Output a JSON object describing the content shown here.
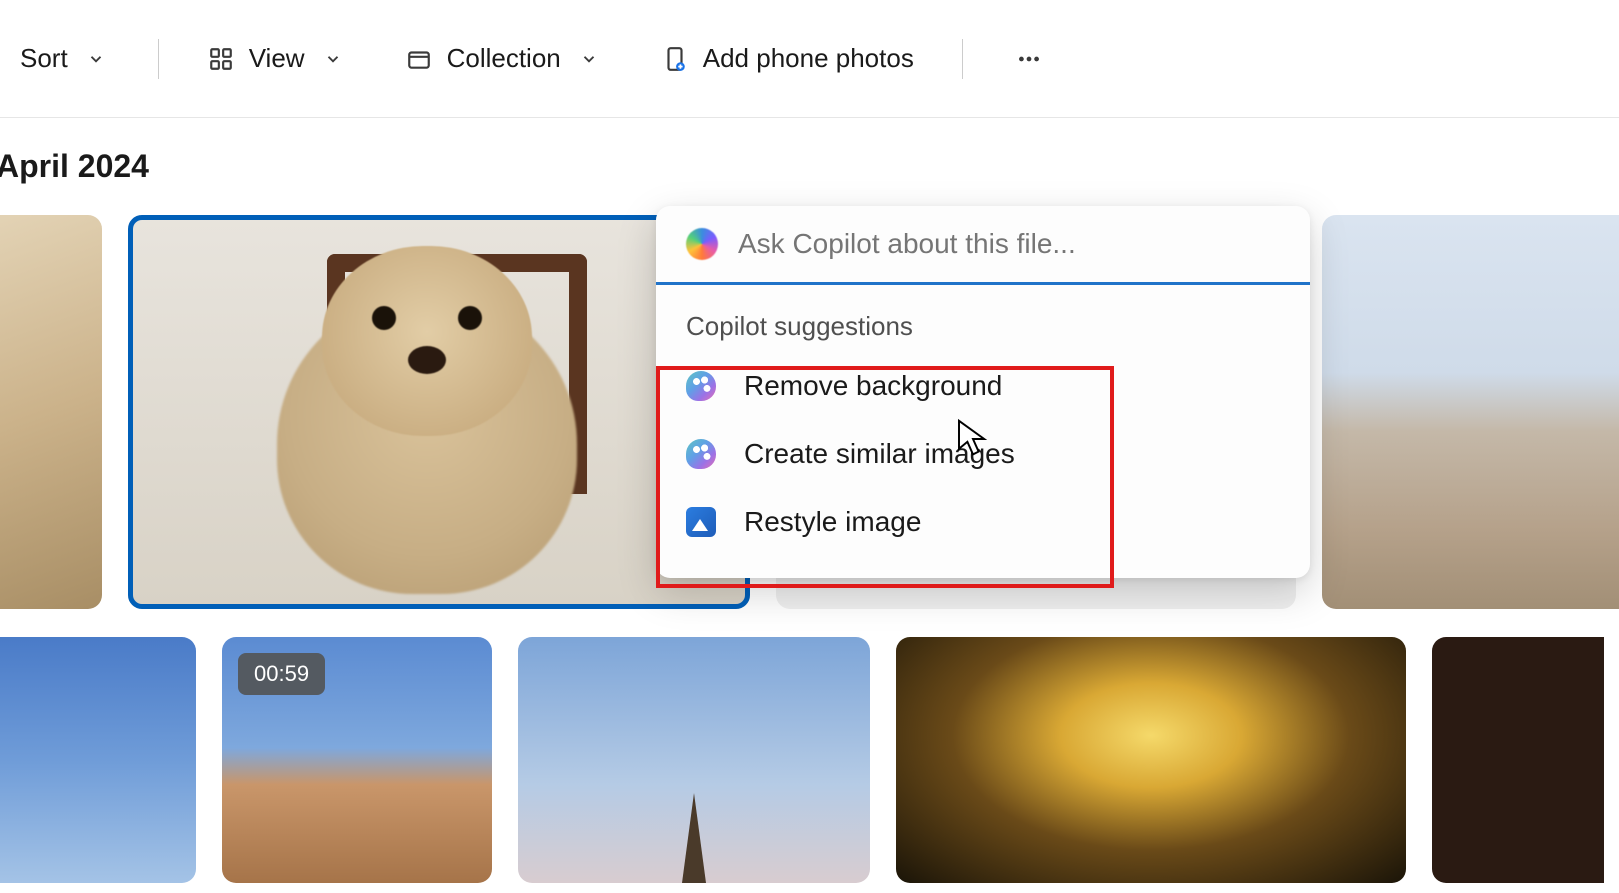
{
  "toolbar": {
    "sort": "Sort",
    "view": "View",
    "collection": "Collection",
    "add_phone": "Add phone photos"
  },
  "section_heading": "April 2024",
  "video_badge": "00:59",
  "copilot": {
    "placeholder": "Ask Copilot about this file...",
    "section_label": "Copilot suggestions",
    "suggestions": {
      "remove_bg": "Remove background",
      "create_similar": "Create similar images",
      "restyle": "Restyle image"
    }
  }
}
